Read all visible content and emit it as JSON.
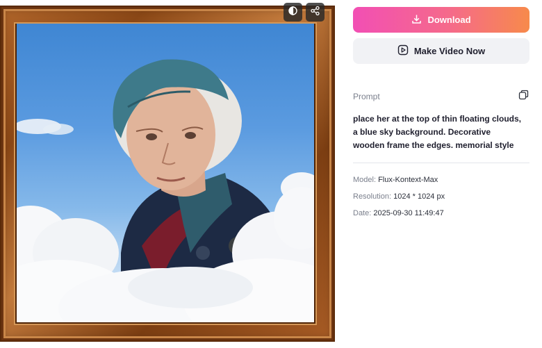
{
  "image": {
    "alt": "",
    "compare_icon": "half-circle-compare-icon",
    "share_icon": "share-icon"
  },
  "actions": {
    "download_label": "Download",
    "download_icon": "download-icon",
    "make_video_label": "Make Video Now",
    "make_video_icon": "play-icon"
  },
  "prompt": {
    "label": "Prompt",
    "text": "place her at the top of thin floating clouds, a blue sky background. Decorative wooden frame the edges. memorial style",
    "copy_icon": "copy-icon"
  },
  "meta": {
    "model_label": "Model:",
    "model_value": "Flux-Kontext-Max",
    "resolution_label": "Resolution:",
    "resolution_value": "1024 * 1024 px",
    "date_label": "Date:",
    "date_value": "2025-09-30 11:49:47"
  },
  "colors": {
    "download_gradient_start": "#f24fb4",
    "download_gradient_end": "#f78a4b",
    "secondary_button_bg": "#f1f2f5",
    "muted_text": "#7a7f8c"
  }
}
